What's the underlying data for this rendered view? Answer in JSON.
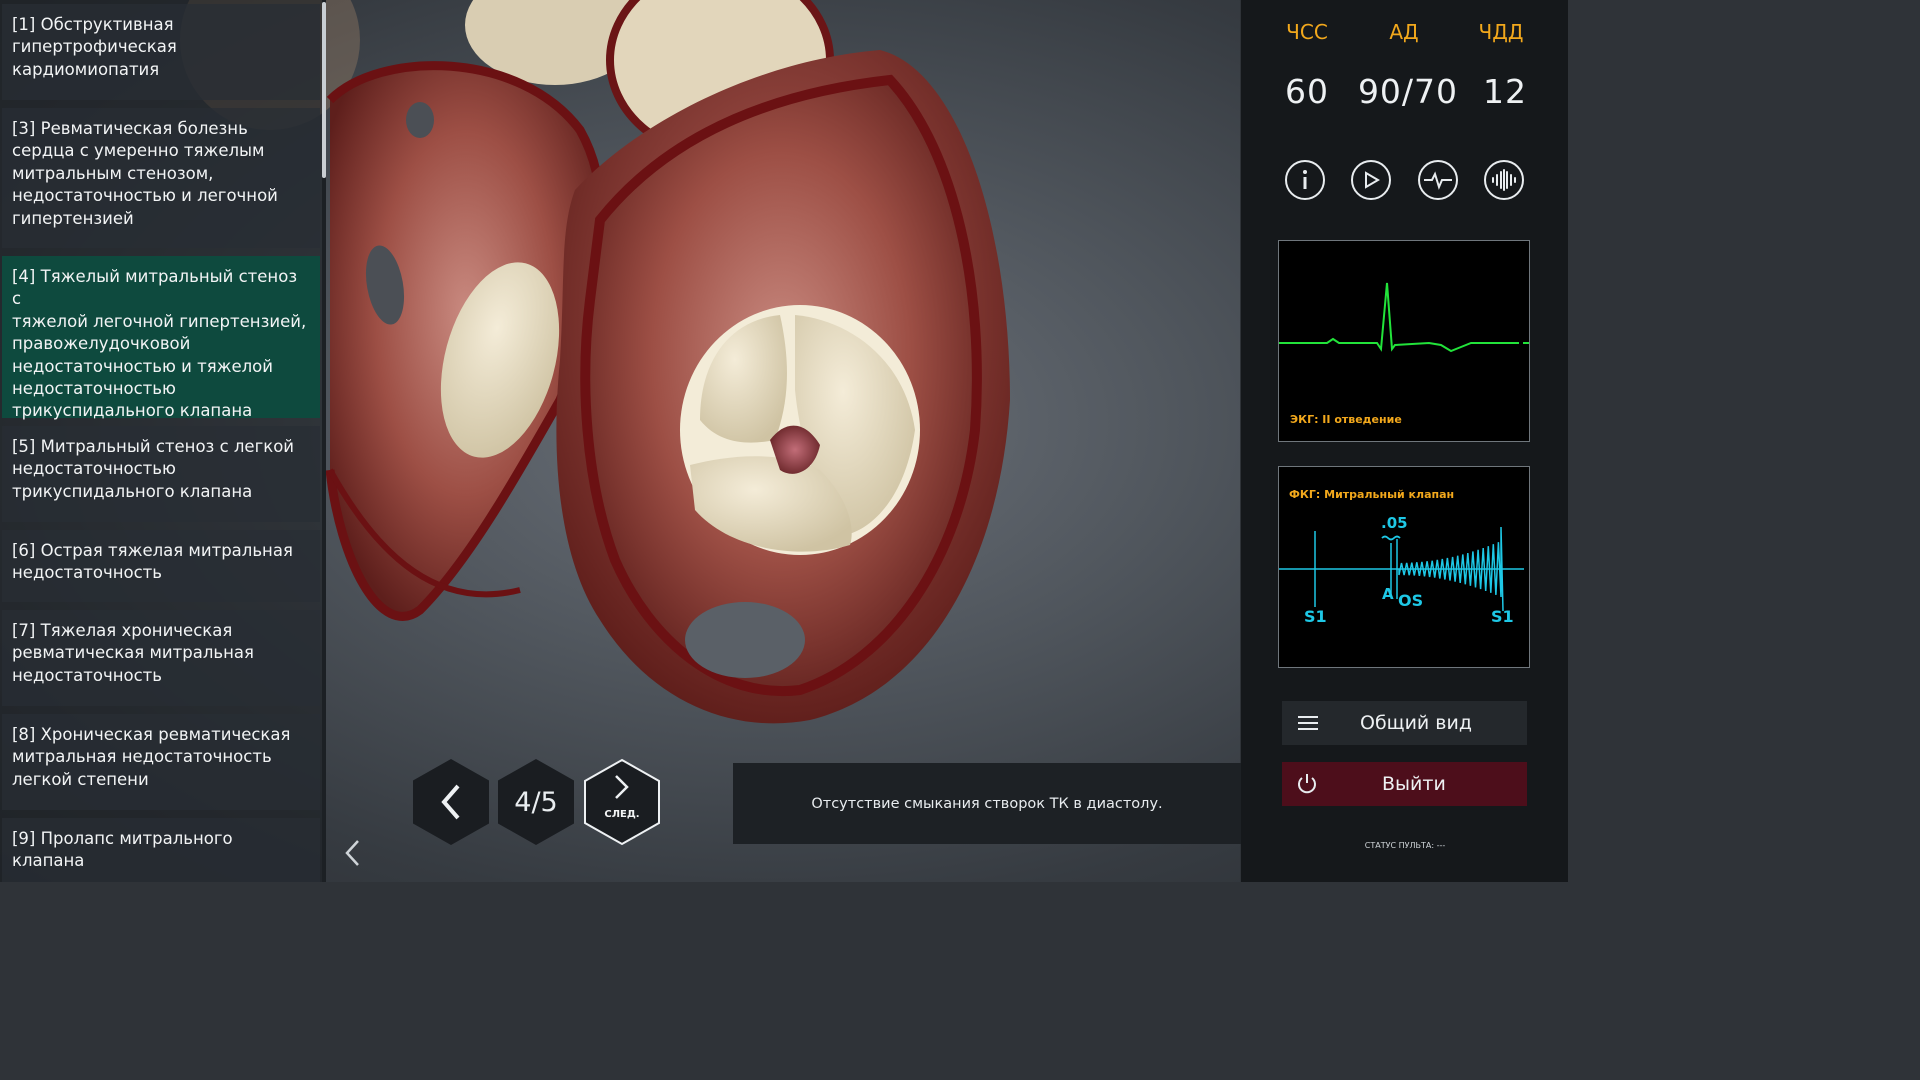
{
  "case_list": {
    "items": [
      {
        "label": "[1] Обструктивная\nгипертрофическая\nкардиомиопатия",
        "active": false
      },
      {
        "label": "[3] Ревматическая болезнь\nсердца с умеренно тяжелым\nмитральным стенозом,\nнедостаточностью и легочной\nгипертензией",
        "active": false
      },
      {
        "label": "[4] Тяжелый митральный стеноз с\nтяжелой легочной гипертензией,\nправожелудочковой\nнедостаточностью и тяжелой\nнедостаточностью\nтрикуспидального клапана",
        "active": true
      },
      {
        "label": "[5] Митральный стеноз с легкой\nнедостаточностью\nтрикуспидального клапана",
        "active": false
      },
      {
        "label": "[6] Острая тяжелая митральная\nнедостаточность",
        "active": false
      },
      {
        "label": "[7] Тяжелая хроническая\nревматическая митральная\nнедостаточность",
        "active": false
      },
      {
        "label": "[8] Хроническая ревматическая\nмитральная недостаточность\nлегкой степени",
        "active": false
      },
      {
        "label": "[9] Пролапс митрального клапана",
        "active": false
      }
    ]
  },
  "nav": {
    "counter": "4/5",
    "next_label": "СЛЕД.",
    "caption": "Отсутствие смыкания створок ТК в диастолу."
  },
  "vitals": {
    "hr_label": "ЧСС",
    "hr_value": "60",
    "bp_label": "АД",
    "bp_value": "90/70",
    "rr_label": "ЧДД",
    "rr_value": "12"
  },
  "controls": {
    "icons": [
      "info-icon",
      "play-icon",
      "heartbeat-icon",
      "sound-wave-icon"
    ]
  },
  "ecg": {
    "label": "ЭКГ: II отведение",
    "trace_color": "#22e33a"
  },
  "pcg": {
    "label": "ФКГ: Митральный клапан",
    "interval": ".05",
    "markers": {
      "s1_left": "S1",
      "a": "A",
      "os": "OS",
      "s1_right": "S1"
    },
    "trace_color": "#1ec8e6"
  },
  "actions": {
    "overview_label": "Общий вид",
    "exit_label": "Выйти"
  },
  "status": {
    "remote": "СТАТУС ПУЛЬТА: ---"
  },
  "colors": {
    "accent_orange": "#f2a81c",
    "active_item": "#0e4a3e",
    "exit_button": "#4d0e1b"
  }
}
